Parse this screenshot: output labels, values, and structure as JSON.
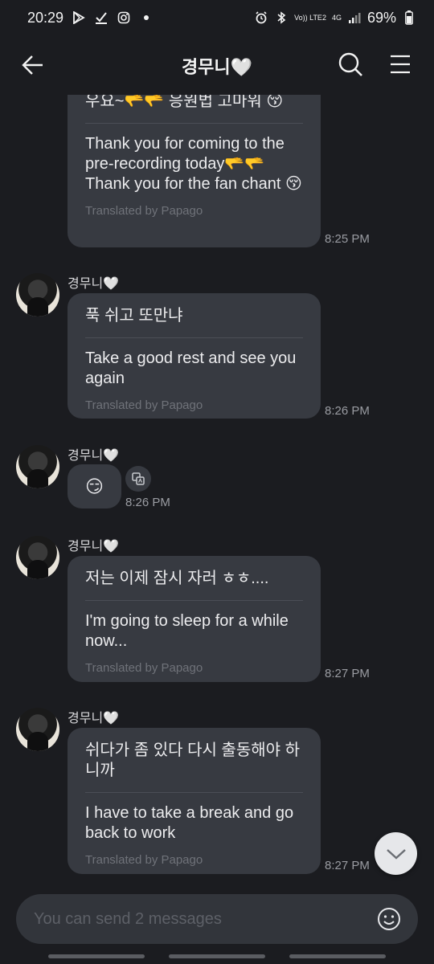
{
  "status_bar": {
    "time": "20:29",
    "left_icons": [
      "play-store-icon",
      "check-icon",
      "instagram-icon",
      "dot-icon"
    ],
    "right_icons": [
      "alarm-icon",
      "bluetooth-icon",
      "volte-icon",
      "signal-icon",
      "battery-icon"
    ],
    "volte_text": "Vo)) LTE2",
    "network_text": "4G",
    "battery": "69%"
  },
  "header": {
    "title": "경무니🤍",
    "back_icon": "arrow-left-icon",
    "search_icon": "search-icon",
    "menu_icon": "menu-icon"
  },
  "messages": [
    {
      "sender": "",
      "original": "우요~🫳🫳 응원법 고마워 😚",
      "translation": "Thank you for coming to the pre-recording today🫳🫳 Thank you for the fan chant 😚",
      "credit": "Translated by Papago",
      "time": "8:25 PM"
    },
    {
      "sender": "경무니🤍",
      "original": "푹 쉬고 또만냐",
      "translation": "Take a good rest and see you again",
      "credit": "Translated by Papago",
      "time": "8:26 PM"
    },
    {
      "sender": "경무니🤍",
      "emoji": "😏",
      "time": "8:26 PM"
    },
    {
      "sender": "경무니🤍",
      "original": "저는 이제 잠시 자러 ㅎㅎ....",
      "translation": "I'm going to sleep for a while now...",
      "credit": "Translated by Papago",
      "time": "8:27 PM"
    },
    {
      "sender": "경무니🤍",
      "original": "쉬다가 좀 있다 다시 출동해야 하니까",
      "translation": "I have to take a break and go back to work",
      "credit": "Translated by Papago",
      "time": "8:27 PM"
    }
  ],
  "input": {
    "placeholder": "You can send 2 messages",
    "emoji_icon": "smiley-icon"
  },
  "colors": {
    "background": "#1b1c20",
    "bubble": "#373a41",
    "input": "#32353b",
    "credit": "#6f7279"
  }
}
